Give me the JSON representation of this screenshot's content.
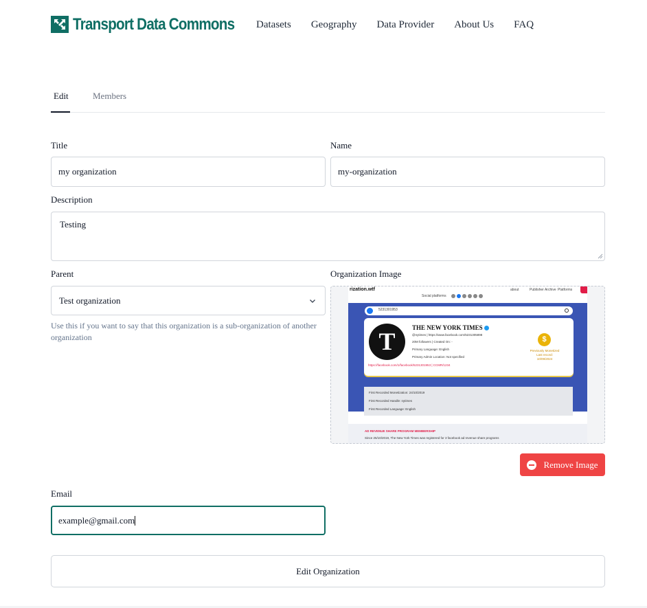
{
  "brand": {
    "name": "Transport Data Commons",
    "color": "#0f6e64",
    "icon": "arrows-out-icon"
  },
  "nav": [
    "Datasets",
    "Geography",
    "Data Provider",
    "About Us",
    "FAQ"
  ],
  "tabs": {
    "edit": "Edit",
    "members": "Members",
    "active": "Edit"
  },
  "form": {
    "title_label": "Title",
    "title_value": "my organization",
    "name_label": "Name",
    "name_value": "my-organization",
    "description_label": "Description",
    "description_value": "Testing",
    "parent_label": "Parent",
    "parent_value": "Test organization",
    "parent_hint": "Use this if you want to say that this organization is a sub-organization of another organization",
    "image_label": "Organization Image",
    "remove_image_label": "Remove Image",
    "email_label": "Email",
    "email_value": "example@gmail.com",
    "submit_label": "Edit Organization"
  },
  "image_preview": {
    "site_name": "rization.wtf",
    "menu": [
      "about",
      "Publisher Archive",
      "Platforms"
    ],
    "sub_menu": "Social platforms",
    "search_query": "5231301953",
    "profile_name": "THE NEW YORK TIMES",
    "profile_lines": [
      "@nytimes | https://www.facebook.com/5231305898",
      "20M followers | Created On: -",
      "Primary Language: English",
      "Primary Admin Location: Not specified"
    ],
    "profile_link": "https://facebook.com/1/facebook/5231301953 | CCMR/1234",
    "monetized_status": "Previously Monetized",
    "monetized_date": "Last record: 10/09/2024",
    "records": [
      "First Recorded Monetization: 24/10/2019",
      "First Recorded Handle: nytimes",
      "First Recorded Language: English"
    ],
    "ad_heading": "AD REVENUE SHARE PROGRAM MEMBERSHIP",
    "since_text": "Since 25/10/2019, The New York Times was registered for 3 facebook ad revenue share programs"
  },
  "colors": {
    "accent": "#0f6e64",
    "danger": "#ef4444",
    "muted": "#6b7280"
  }
}
